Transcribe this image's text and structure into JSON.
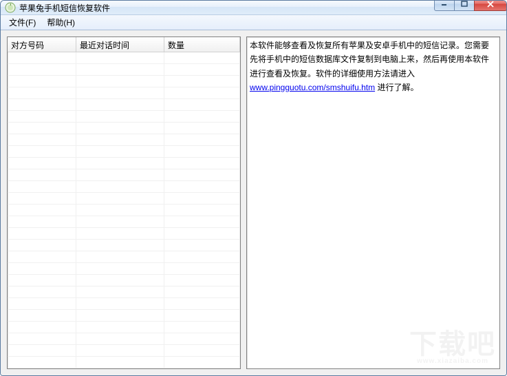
{
  "window": {
    "title": "苹果兔手机短信恢复软件"
  },
  "menu": {
    "file": "文件(F)",
    "help": "帮助(H)"
  },
  "table": {
    "headers": {
      "number": "对方号码",
      "last_time": "最近对话时间",
      "count": "数量"
    },
    "rows": []
  },
  "info": {
    "p1": "本软件能够查看及恢复所有苹果及安卓手机中的短信记录。您需要先将手机中的短信数据库文件复制到电脑上来，然后再使用本软件进行查看及恢复。软件的详细使用方法请进入",
    "link": "www.pingguotu.com/smshuifu.htm",
    "p2": "进行了解。"
  },
  "watermark": {
    "main": "下载吧",
    "sub": "www.xiazaiba.com"
  }
}
